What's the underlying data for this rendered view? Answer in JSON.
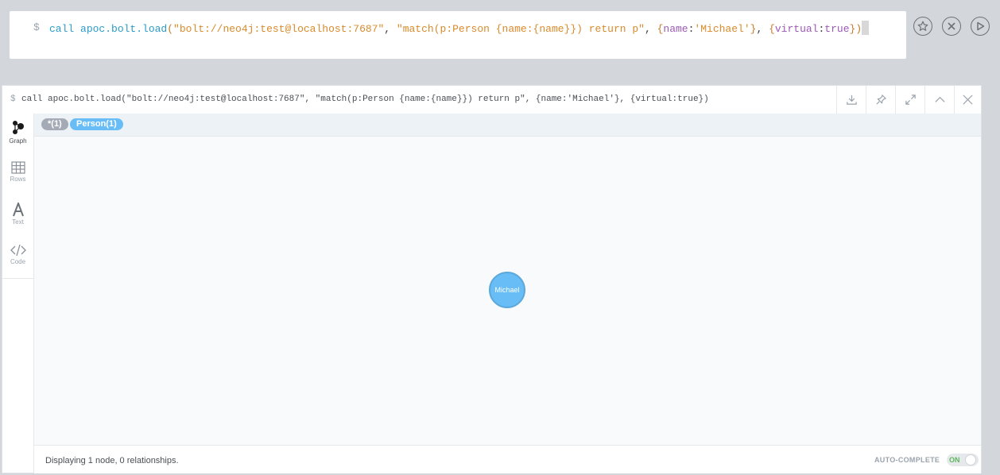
{
  "editor": {
    "prompt": "$",
    "tokens": [
      {
        "t": "call ",
        "c": "kw"
      },
      {
        "t": "apoc.bolt.load",
        "c": "fn"
      },
      {
        "t": "(",
        "c": "punct"
      },
      {
        "t": "\"bolt://neo4j:test@localhost:7687\"",
        "c": "str"
      },
      {
        "t": ", ",
        "c": "plain"
      },
      {
        "t": "\"match(p:Person {name:{name}}) return p\"",
        "c": "str"
      },
      {
        "t": ", ",
        "c": "plain"
      },
      {
        "t": "{",
        "c": "punct"
      },
      {
        "t": "name",
        "c": "key"
      },
      {
        "t": ":",
        "c": "plain"
      },
      {
        "t": "'Michael'",
        "c": "str"
      },
      {
        "t": "}",
        "c": "punct"
      },
      {
        "t": ", ",
        "c": "plain"
      },
      {
        "t": "{",
        "c": "punct"
      },
      {
        "t": "virtual",
        "c": "key"
      },
      {
        "t": ":",
        "c": "plain"
      },
      {
        "t": "true",
        "c": "key"
      },
      {
        "t": "}",
        "c": "punct"
      },
      {
        "t": ")",
        "c": "punct"
      }
    ],
    "buttons": {
      "favorite": "star-icon",
      "clear": "close-circle-icon",
      "run": "play-icon"
    }
  },
  "frame": {
    "prompt": "$",
    "query": "call apoc.bolt.load(\"bolt://neo4j:test@localhost:7687\", \"match(p:Person {name:{name}}) return p\", {name:'Michael'}, {virtual:true})",
    "header_buttons": [
      "download-icon",
      "pin-icon",
      "expand-icon",
      "collapse-icon",
      "close-icon"
    ]
  },
  "sidebar": {
    "items": [
      {
        "label": "Graph",
        "icon": "graph-icon",
        "active": true
      },
      {
        "label": "Rows",
        "icon": "table-icon",
        "active": false
      },
      {
        "label": "Text",
        "icon": "text-icon",
        "active": false
      },
      {
        "label": "Code",
        "icon": "code-icon",
        "active": false
      }
    ]
  },
  "legend": {
    "all": "*(1)",
    "person": "Person(1)"
  },
  "graph": {
    "nodes": [
      {
        "label": "Michael",
        "type": "Person"
      }
    ]
  },
  "status": {
    "text": "Displaying 1 node, 0 relationships.",
    "autocomplete_label": "AUTO-COMPLETE",
    "toggle_label": "ON"
  },
  "colors": {
    "node": "#68bdf6",
    "pill_all": "#a5abb6",
    "accent": "#2b9bc6"
  }
}
